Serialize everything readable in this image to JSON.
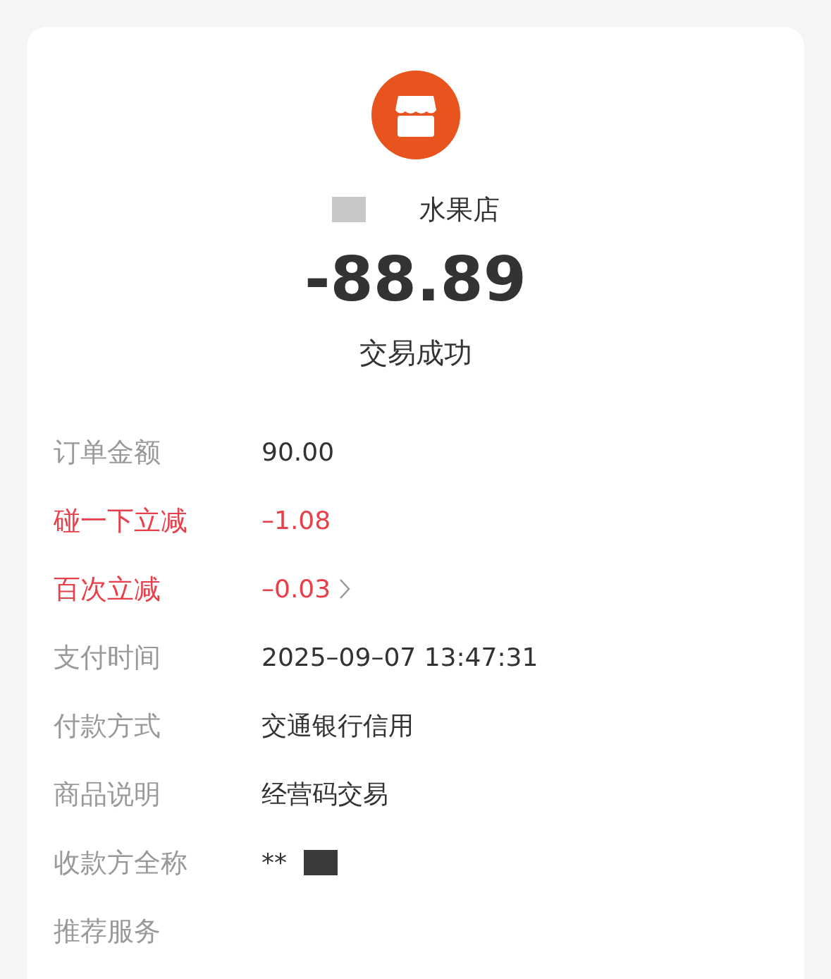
{
  "merchant": {
    "name": "水果店"
  },
  "amount": "-88.89",
  "status": "交易成功",
  "details": [
    {
      "label": "订单金额",
      "value": "90.00",
      "kind": "plain",
      "arrow": false
    },
    {
      "label": "碰一下立减",
      "value": "–1.08",
      "kind": "discount",
      "arrow": false
    },
    {
      "label": "百次立减",
      "value": "–0.03",
      "kind": "discount",
      "arrow": true
    },
    {
      "label": "支付时间",
      "value": "2025–09–07 13:47:31",
      "kind": "plain",
      "arrow": false
    },
    {
      "label": "付款方式",
      "value": "交通银行信用",
      "kind": "plain",
      "arrow": false
    },
    {
      "label": "商品说明",
      "value": "经营码交易",
      "kind": "plain",
      "arrow": false
    },
    {
      "label": "收款方全称",
      "value": "**",
      "kind": "plain",
      "arrow": false
    },
    {
      "label": "推荐服务",
      "kind": "plain",
      "arrow": false
    }
  ]
}
